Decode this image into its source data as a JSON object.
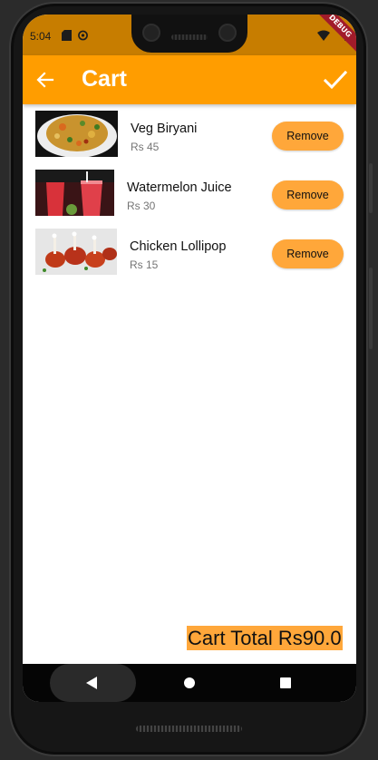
{
  "status_bar": {
    "time": "5:04",
    "debug_label": "DEBUG"
  },
  "app_bar": {
    "title": "Cart",
    "back_icon": "arrow-left",
    "confirm_icon": "check"
  },
  "cart": {
    "items": [
      {
        "name": "Veg Biryani",
        "price": "Rs 45",
        "remove_label": "Remove",
        "image": "veg-biryani-photo"
      },
      {
        "name": "Watermelon Juice",
        "price": "Rs 30",
        "remove_label": "Remove",
        "image": "watermelon-juice-photo"
      },
      {
        "name": "Chicken Lollipop",
        "price": "Rs 15",
        "remove_label": "Remove",
        "image": "chicken-lollipop-photo"
      }
    ],
    "total_text": "Cart Total Rs90.0"
  },
  "colors": {
    "status_bar": "#c77d00",
    "app_bar": "#ff9d00",
    "button": "#ffa73a",
    "debug_banner": "#a11b2a"
  }
}
